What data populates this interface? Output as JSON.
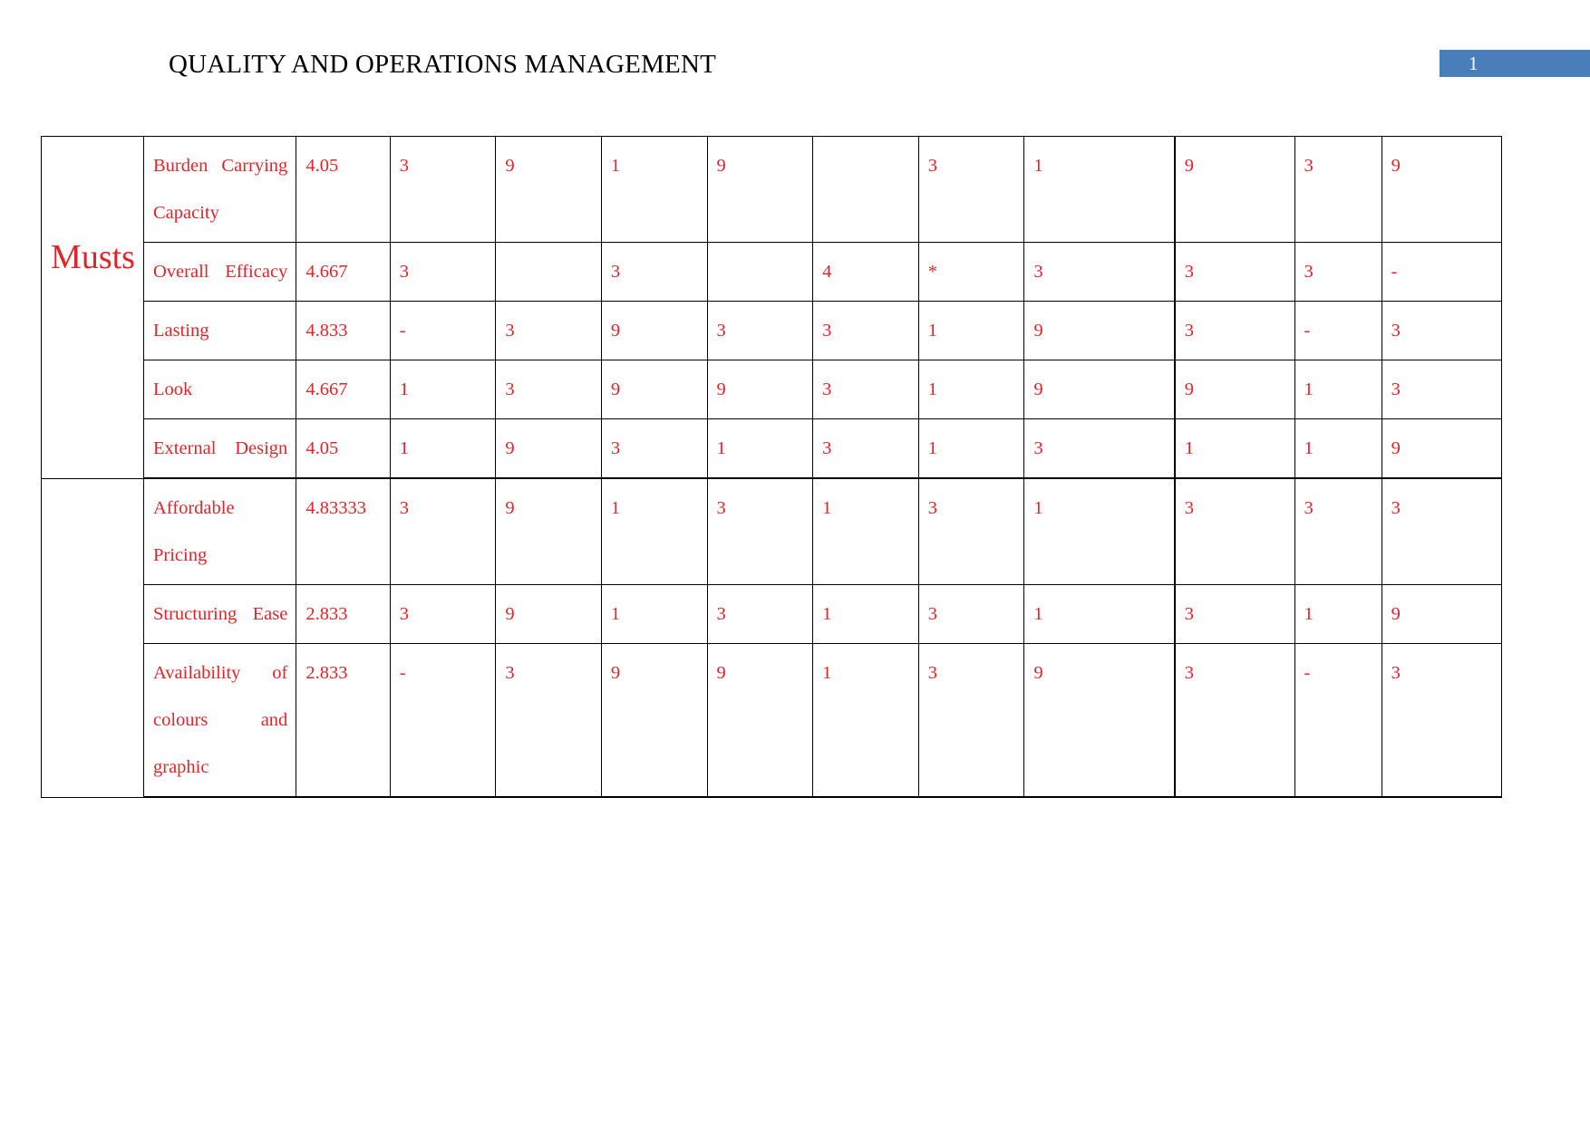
{
  "header": {
    "title": "QUALITY AND OPERATIONS MANAGEMENT",
    "page_number": "1",
    "badge_color": "#4a7ebb"
  },
  "table": {
    "text_color": "#e0262b",
    "groups": [
      {
        "label": "Musts",
        "row_span": 5
      },
      {
        "label": "",
        "row_span": 3
      }
    ],
    "rows": [
      {
        "group": "Musts",
        "need": "Burden Carrying Capacity",
        "importance": "4.05",
        "values": [
          "3",
          "9",
          "1",
          "9",
          "",
          "3",
          "1",
          "9",
          "3",
          "9"
        ]
      },
      {
        "group": "Musts",
        "need": "Overall Efficacy",
        "importance": "4.667",
        "values": [
          "3",
          "",
          "3",
          "",
          "4",
          "*",
          "3",
          "3",
          "3",
          "-"
        ]
      },
      {
        "group": "Musts",
        "need": "Lasting",
        "importance": "4.833",
        "values": [
          "-",
          "3",
          "9",
          "3",
          "3",
          "1",
          "9",
          "3",
          "-",
          "3"
        ]
      },
      {
        "group": "Musts",
        "need": "Look",
        "importance": "4.667",
        "values": [
          "1",
          "3",
          "9",
          "9",
          "3",
          "1",
          "9",
          "9",
          "1",
          "3"
        ]
      },
      {
        "group": "Musts",
        "need": "External Design",
        "importance": "4.05",
        "values": [
          "1",
          "9",
          "3",
          "1",
          "3",
          "1",
          "3",
          "1",
          "1",
          "9"
        ]
      },
      {
        "group": "",
        "need": "Affordable Pricing",
        "importance": "4.83333",
        "values": [
          "3",
          "9",
          "1",
          "3",
          "1",
          "3",
          "1",
          "3",
          "3",
          "3"
        ]
      },
      {
        "group": "",
        "need": "Structuring Ease",
        "importance": "2.833",
        "values": [
          "3",
          "9",
          "1",
          "3",
          "1",
          "3",
          "1",
          "3",
          "1",
          "9"
        ]
      },
      {
        "group": "",
        "need": "Availability of colours and graphic",
        "importance": "2.833",
        "values": [
          "-",
          "3",
          "9",
          "9",
          "1",
          "3",
          "9",
          "3",
          "-",
          "3"
        ]
      }
    ]
  }
}
